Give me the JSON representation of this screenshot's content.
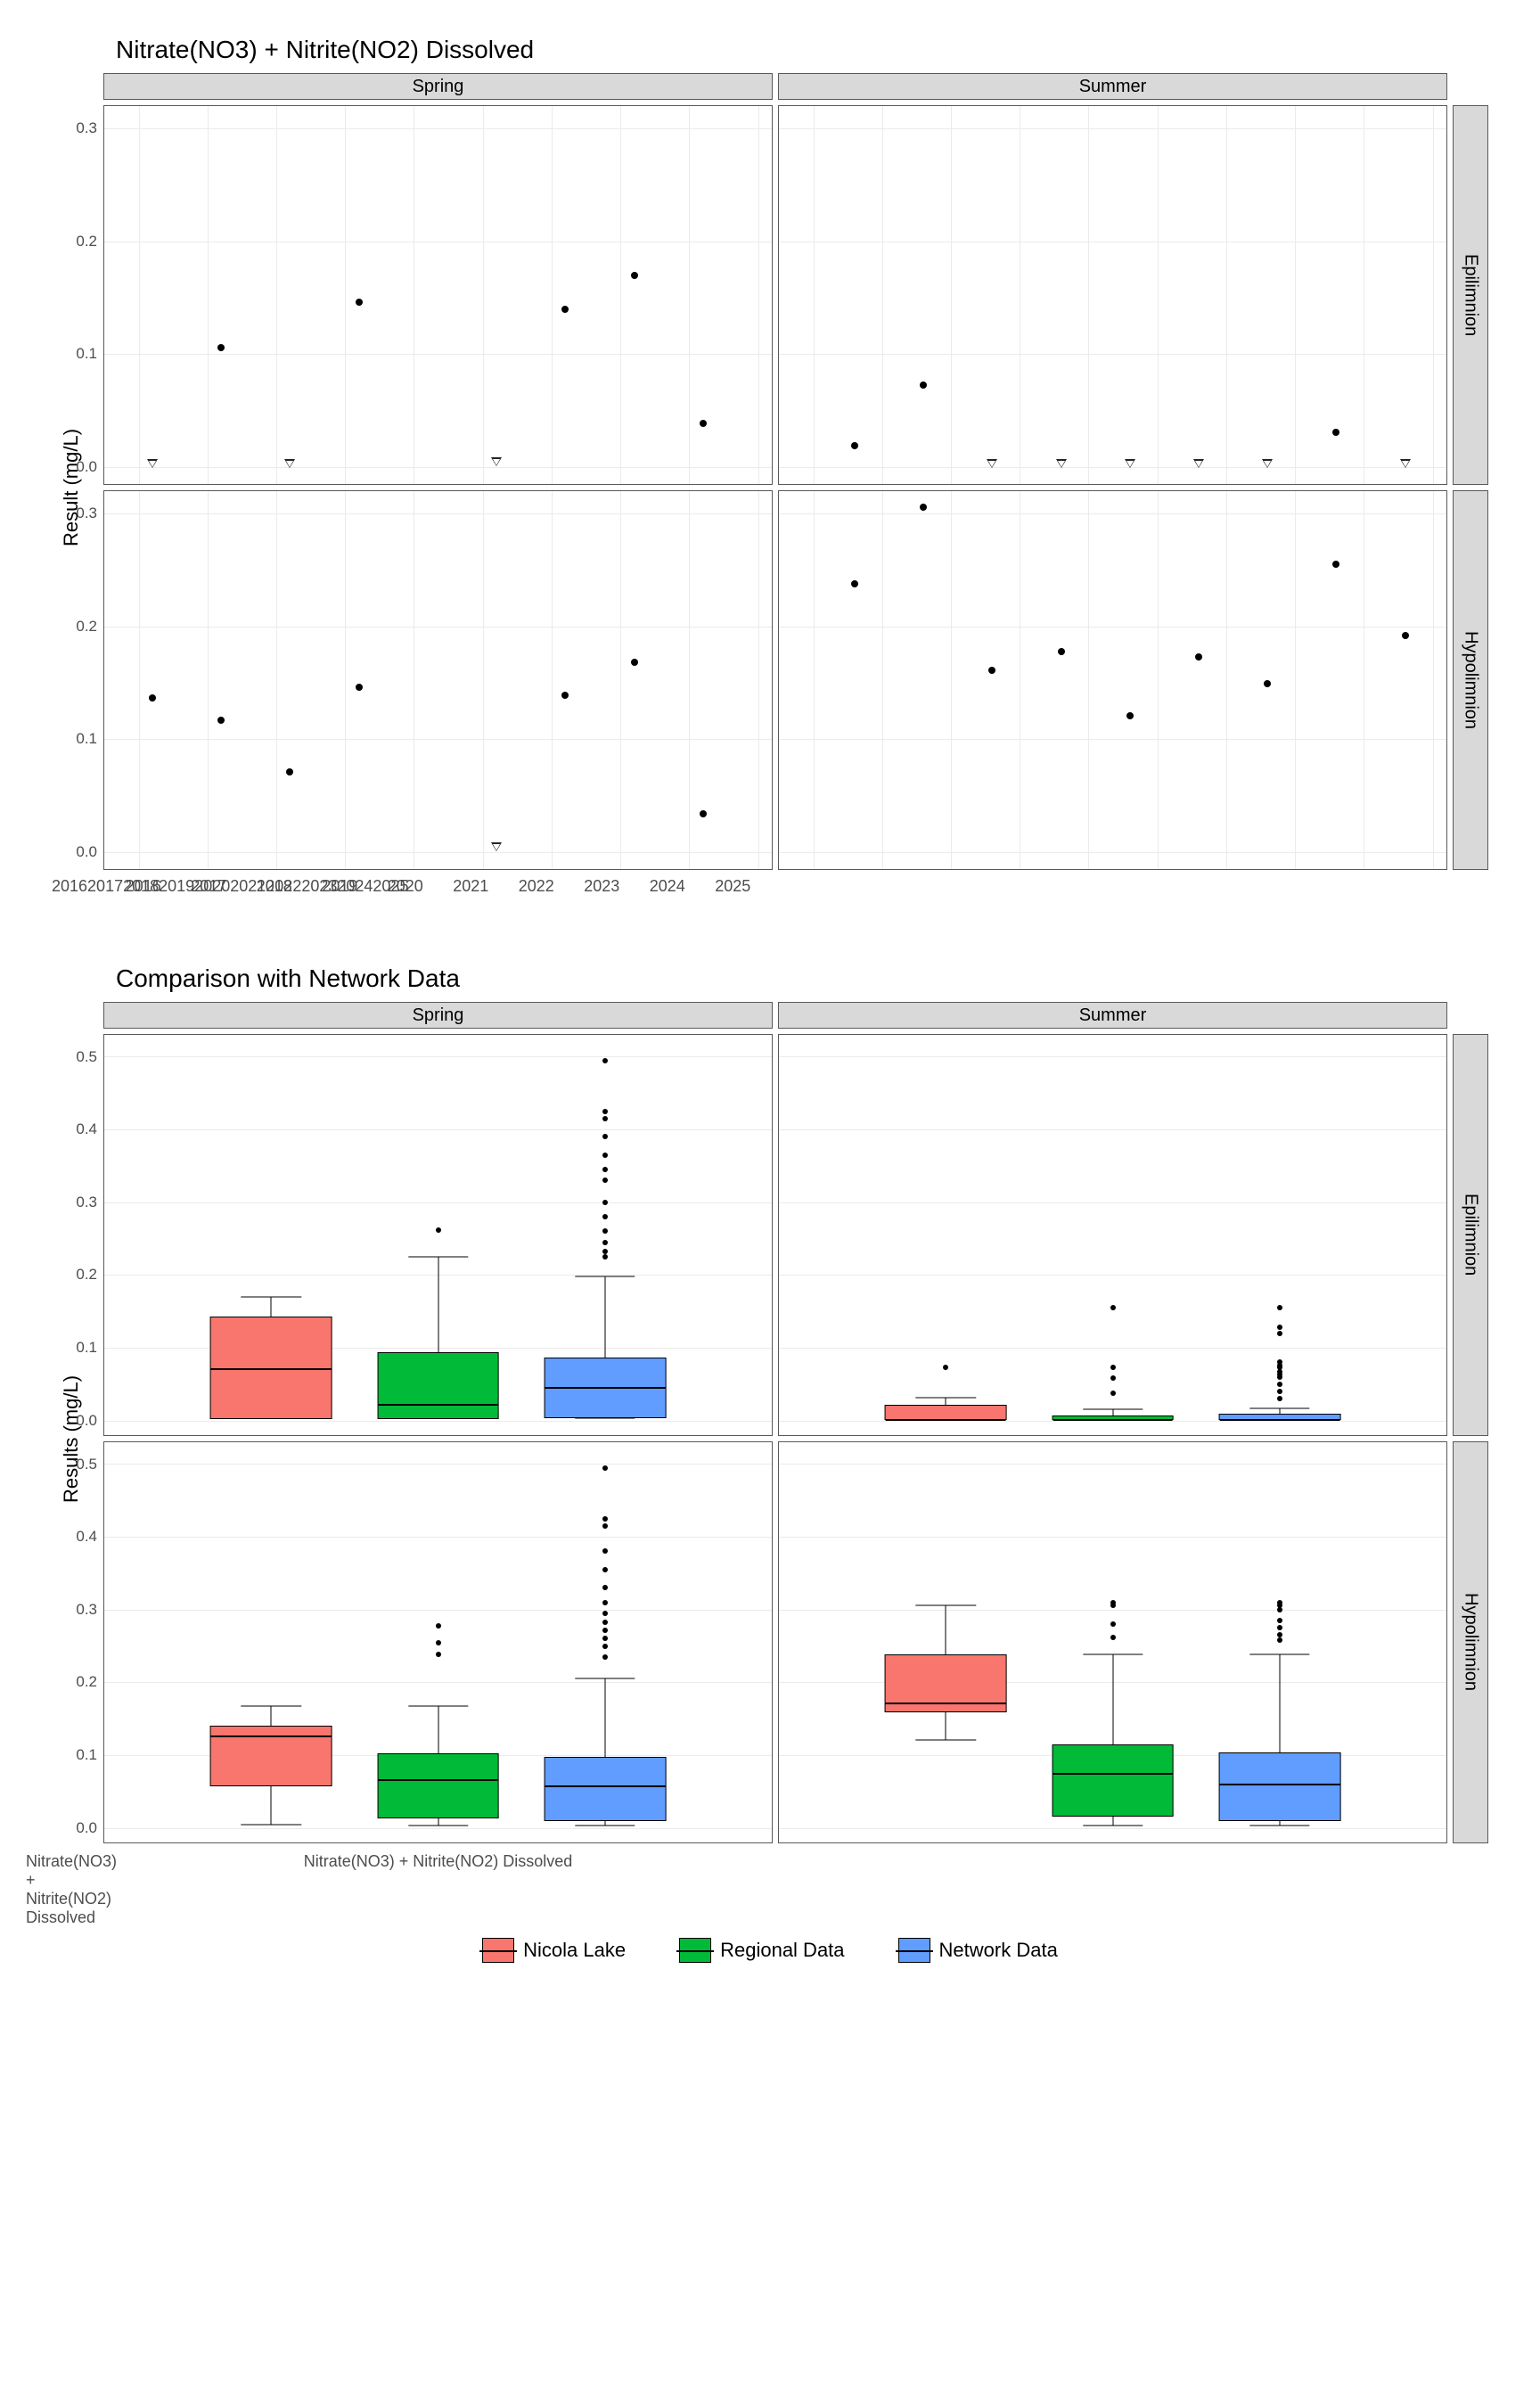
{
  "chart_data": [
    {
      "type": "scatter",
      "title": "Nitrate(NO3) + Nitrite(NO2) Dissolved",
      "xlabel": "",
      "ylabel": "Result (mg/L)",
      "xlim": [
        2015.5,
        2025.2
      ],
      "ylim": [
        -0.015,
        0.32
      ],
      "x_ticks": [
        2016,
        2017,
        2018,
        2019,
        2020,
        2021,
        2022,
        2023,
        2024,
        2025
      ],
      "y_ticks": [
        0.0,
        0.1,
        0.2,
        0.3
      ],
      "col_facets": [
        "Spring",
        "Summer"
      ],
      "row_facets": [
        "Epilimnion",
        "Hypolimnion"
      ],
      "panels": {
        "Spring|Epilimnion": {
          "points": [
            {
              "x": 2017.2,
              "y": 0.106
            },
            {
              "x": 2019.2,
              "y": 0.146
            },
            {
              "x": 2022.2,
              "y": 0.14
            },
            {
              "x": 2023.2,
              "y": 0.17
            },
            {
              "x": 2024.2,
              "y": 0.039
            }
          ],
          "censored": [
            {
              "x": 2016.2,
              "y": 0.003
            },
            {
              "x": 2018.2,
              "y": 0.003
            },
            {
              "x": 2021.2,
              "y": 0.005
            }
          ]
        },
        "Summer|Epilimnion": {
          "points": [
            {
              "x": 2016.6,
              "y": 0.019
            },
            {
              "x": 2017.6,
              "y": 0.073
            },
            {
              "x": 2023.6,
              "y": 0.031
            }
          ],
          "censored": [
            {
              "x": 2018.6,
              "y": 0.003
            },
            {
              "x": 2019.6,
              "y": 0.003
            },
            {
              "x": 2020.6,
              "y": 0.003
            },
            {
              "x": 2021.6,
              "y": 0.003
            },
            {
              "x": 2022.6,
              "y": 0.003
            },
            {
              "x": 2024.6,
              "y": 0.003
            }
          ]
        },
        "Spring|Hypolimnion": {
          "points": [
            {
              "x": 2016.2,
              "y": 0.137
            },
            {
              "x": 2017.2,
              "y": 0.117
            },
            {
              "x": 2018.2,
              "y": 0.071
            },
            {
              "x": 2019.2,
              "y": 0.146
            },
            {
              "x": 2022.2,
              "y": 0.139
            },
            {
              "x": 2023.2,
              "y": 0.168
            },
            {
              "x": 2024.2,
              "y": 0.034
            }
          ],
          "censored": [
            {
              "x": 2021.2,
              "y": 0.005
            }
          ]
        },
        "Summer|Hypolimnion": {
          "points": [
            {
              "x": 2016.6,
              "y": 0.238
            },
            {
              "x": 2017.6,
              "y": 0.306
            },
            {
              "x": 2018.6,
              "y": 0.161
            },
            {
              "x": 2019.6,
              "y": 0.178
            },
            {
              "x": 2020.6,
              "y": 0.121
            },
            {
              "x": 2021.6,
              "y": 0.173
            },
            {
              "x": 2022.6,
              "y": 0.149
            },
            {
              "x": 2023.6,
              "y": 0.255
            },
            {
              "x": 2024.6,
              "y": 0.192
            }
          ],
          "censored": []
        }
      }
    },
    {
      "type": "boxplot",
      "title": "Comparison with Network Data",
      "xlabel": "Nitrate(NO3) + Nitrite(NO2) Dissolved",
      "ylabel": "Results (mg/L)",
      "ylim": [
        -0.02,
        0.53
      ],
      "y_ticks": [
        0.0,
        0.1,
        0.2,
        0.3,
        0.4,
        0.5
      ],
      "col_facets": [
        "Spring",
        "Summer"
      ],
      "row_facets": [
        "Epilimnion",
        "Hypolimnion"
      ],
      "series": [
        {
          "name": "Nicola Lake",
          "color": "#F8766D"
        },
        {
          "name": "Regional Data",
          "color": "#00BA38"
        },
        {
          "name": "Network Data",
          "color": "#619CFF"
        }
      ],
      "panels": {
        "Spring|Epilimnion": {
          "Nicola Lake": {
            "min": 0.003,
            "q1": 0.005,
            "med": 0.073,
            "q3": 0.143,
            "max": 0.17,
            "out": []
          },
          "Regional Data": {
            "min": 0.003,
            "q1": 0.005,
            "med": 0.024,
            "q3": 0.094,
            "max": 0.225,
            "out": [
              0.262
            ]
          },
          "Network Data": {
            "min": 0.003,
            "q1": 0.006,
            "med": 0.047,
            "q3": 0.086,
            "max": 0.198,
            "out": [
              0.225,
              0.232,
              0.245,
              0.26,
              0.28,
              0.3,
              0.33,
              0.345,
              0.365,
              0.39,
              0.415,
              0.425,
              0.495
            ]
          }
        },
        "Summer|Epilimnion": {
          "Nicola Lake": {
            "min": 0.003,
            "q1": 0.003,
            "med": 0.003,
            "q3": 0.022,
            "max": 0.031,
            "out": [
              0.073
            ]
          },
          "Regional Data": {
            "min": 0.003,
            "q1": 0.003,
            "med": 0.003,
            "q3": 0.007,
            "max": 0.015,
            "out": [
              0.037,
              0.058,
              0.073,
              0.155
            ]
          },
          "Network Data": {
            "min": 0.003,
            "q1": 0.003,
            "med": 0.003,
            "q3": 0.009,
            "max": 0.017,
            "out": [
              0.03,
              0.04,
              0.05,
              0.06,
              0.063,
              0.067,
              0.073,
              0.076,
              0.08,
              0.12,
              0.128,
              0.155
            ]
          }
        },
        "Spring|Hypolimnion": {
          "Nicola Lake": {
            "min": 0.005,
            "q1": 0.06,
            "med": 0.128,
            "q3": 0.141,
            "max": 0.168,
            "out": []
          },
          "Regional Data": {
            "min": 0.003,
            "q1": 0.015,
            "med": 0.068,
            "q3": 0.102,
            "max": 0.168,
            "out": [
              0.238,
              0.255,
              0.278
            ]
          },
          "Network Data": {
            "min": 0.003,
            "q1": 0.012,
            "med": 0.059,
            "q3": 0.098,
            "max": 0.205,
            "out": [
              0.235,
              0.25,
              0.26,
              0.272,
              0.283,
              0.295,
              0.31,
              0.33,
              0.355,
              0.38,
              0.415,
              0.425,
              0.495
            ]
          }
        },
        "Summer|Hypolimnion": {
          "Nicola Lake": {
            "min": 0.121,
            "q1": 0.161,
            "med": 0.173,
            "q3": 0.238,
            "max": 0.306,
            "out": []
          },
          "Regional Data": {
            "min": 0.003,
            "q1": 0.018,
            "med": 0.077,
            "q3": 0.115,
            "max": 0.238,
            "out": [
              0.262,
              0.28,
              0.306,
              0.31
            ]
          },
          "Network Data": {
            "min": 0.003,
            "q1": 0.012,
            "med": 0.062,
            "q3": 0.104,
            "max": 0.238,
            "out": [
              0.258,
              0.265,
              0.275,
              0.285,
              0.3,
              0.306,
              0.31
            ]
          }
        }
      }
    }
  ],
  "legend": {
    "items": [
      "Nicola Lake",
      "Regional Data",
      "Network Data"
    ]
  },
  "axis_labels": {
    "scatter_y": "Result (mg/L)",
    "box_y": "Results (mg/L)",
    "box_x": "Nitrate(NO3) + Nitrite(NO2) Dissolved"
  }
}
